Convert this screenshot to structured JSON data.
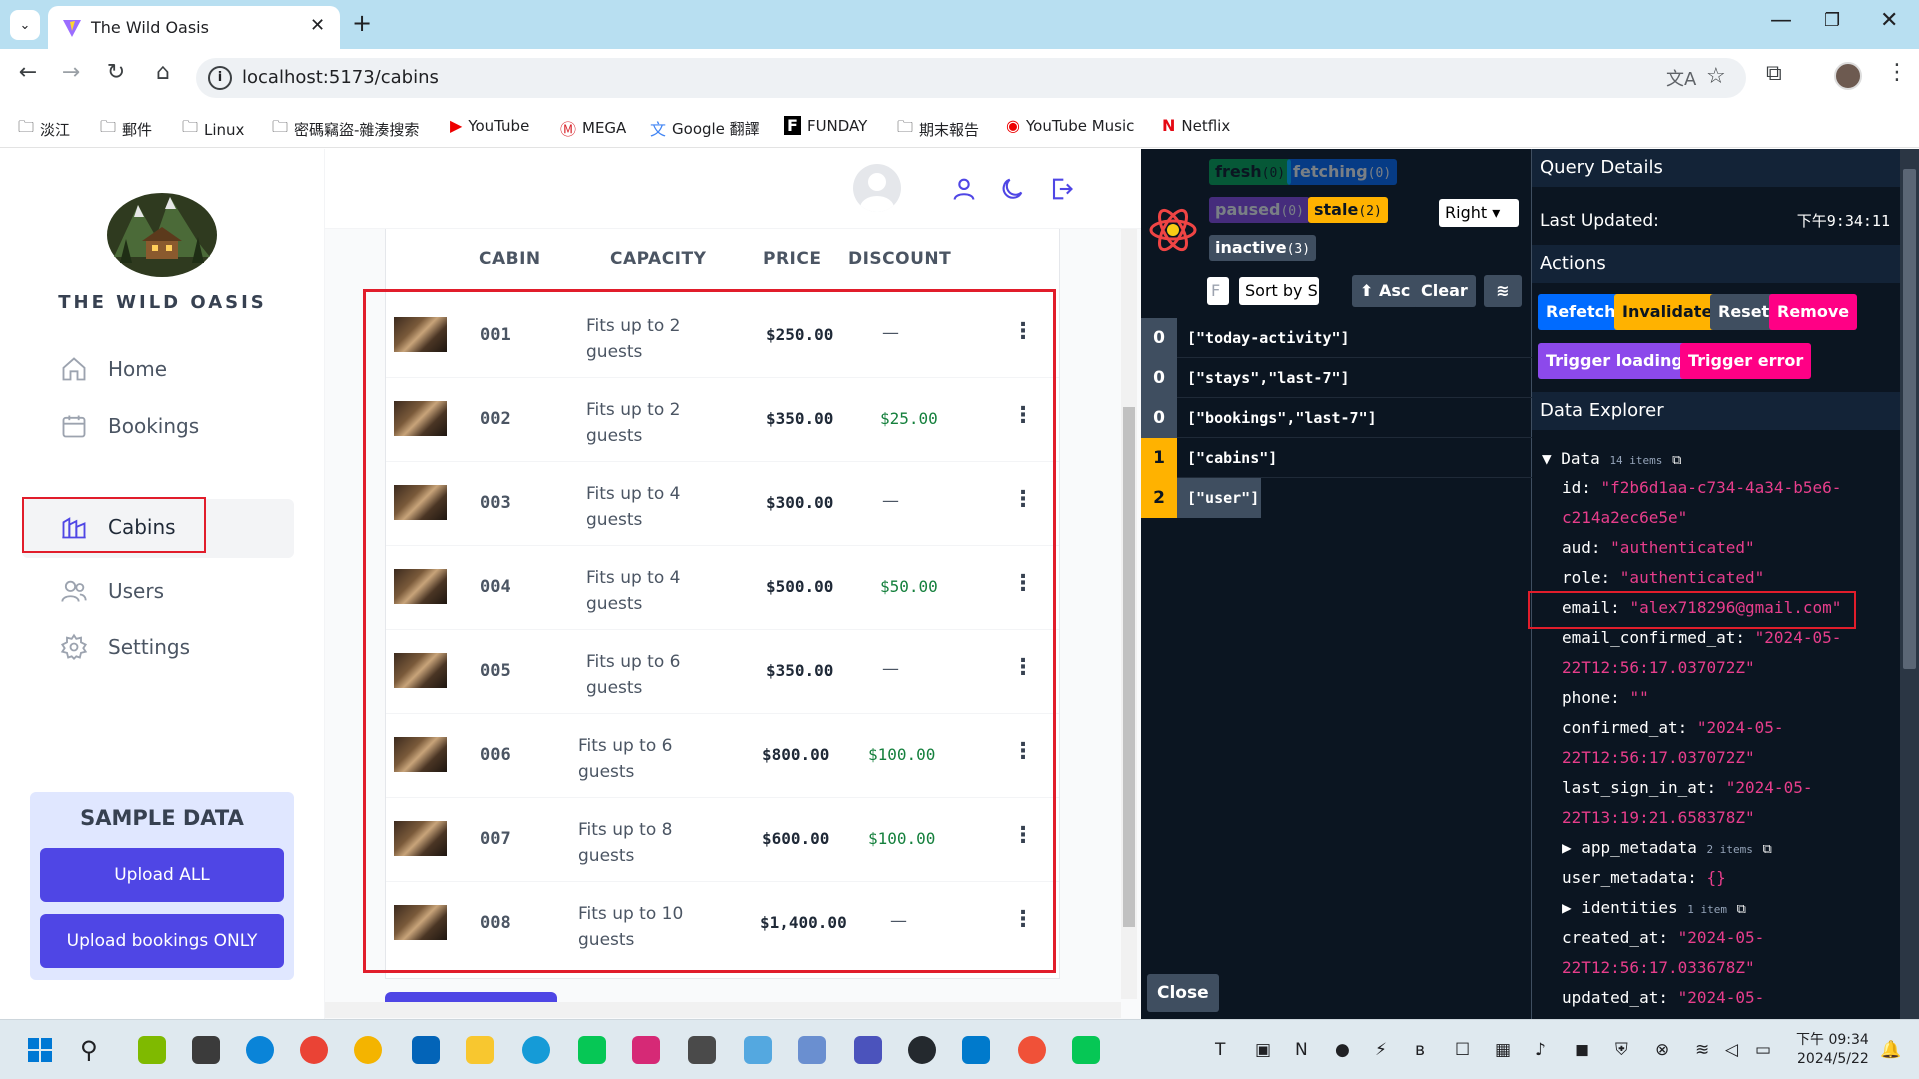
{
  "browser": {
    "tab_title": "The Wild Oasis",
    "url": "localhost:5173/cabins",
    "bookmarks": [
      "淡江",
      "郵件",
      "Linux",
      "密碼竊盜-雜湊搜索",
      "YouTube",
      "MEGA",
      "Google 翻譯",
      "FUNDAY",
      "期末報告",
      "YouTube Music",
      "Netflix"
    ]
  },
  "app": {
    "logo_text": "THE WILD OASIS",
    "nav": [
      {
        "label": "Home",
        "icon": "home-icon"
      },
      {
        "label": "Bookings",
        "icon": "calendar-icon"
      },
      {
        "label": "Cabins",
        "icon": "cabin-icon",
        "active": true
      },
      {
        "label": "Users",
        "icon": "users-icon"
      },
      {
        "label": "Settings",
        "icon": "gear-icon"
      }
    ],
    "sample": {
      "title": "SAMPLE DATA",
      "upload_all": "Upload ALL",
      "upload_bookings": "Upload bookings ONLY"
    },
    "table": {
      "headers": [
        "CABIN",
        "CAPACITY",
        "PRICE",
        "DISCOUNT"
      ],
      "rows": [
        {
          "name": "001",
          "capacity_1": "Fits up to 2",
          "capacity_2": "guests",
          "price": "$250.00",
          "discount": "—"
        },
        {
          "name": "002",
          "capacity_1": "Fits up to 2",
          "capacity_2": "guests",
          "price": "$350.00",
          "discount": "$25.00"
        },
        {
          "name": "003",
          "capacity_1": "Fits up to 4",
          "capacity_2": "guests",
          "price": "$300.00",
          "discount": "—"
        },
        {
          "name": "004",
          "capacity_1": "Fits up to 4",
          "capacity_2": "guests",
          "price": "$500.00",
          "discount": "$50.00"
        },
        {
          "name": "005",
          "capacity_1": "Fits up to 6",
          "capacity_2": "guests",
          "price": "$350.00",
          "discount": "—"
        },
        {
          "name": "006",
          "capacity_1": "Fits up to 6",
          "capacity_2": "guests",
          "price": "$800.00",
          "discount": "$100.00"
        },
        {
          "name": "007",
          "capacity_1": "Fits up to 8",
          "capacity_2": "guests",
          "price": "$600.00",
          "discount": "$100.00"
        },
        {
          "name": "008",
          "capacity_1": "Fits up to 10",
          "capacity_2": "guests",
          "price": "$1,400.00",
          "discount": "—"
        }
      ]
    }
  },
  "devtools": {
    "badges": {
      "fresh": "fresh",
      "fresh_count": "(0)",
      "fetching": "fetching",
      "fetching_count": "(0)",
      "paused": "paused",
      "paused_count": "(0)",
      "stale": "stale",
      "stale_count": "(2)",
      "inactive": "inactive",
      "inactive_count": "(3)"
    },
    "position_select": "Right",
    "filter_placeholder": "F",
    "sort_select": "Sort by S",
    "asc_button": "⬆ Asc",
    "clear_button": "Clear",
    "queries": [
      {
        "count": "0",
        "key": "[\"today-activity\"]",
        "color": "#3f4e60"
      },
      {
        "count": "0",
        "key": "[\"stays\",\"last-7\"]",
        "color": "#3f4e60"
      },
      {
        "count": "0",
        "key": "[\"bookings\",\"last-7\"]",
        "color": "#3f4e60"
      },
      {
        "count": "1",
        "key": "[\"cabins\"]",
        "color": "#ffb200"
      },
      {
        "count": "2",
        "key": "[\"user\"]",
        "color": "#ffb200"
      }
    ],
    "close_button": "Close",
    "details": {
      "query_details": "Query Details",
      "last_updated_label": "Last Updated:",
      "last_updated_value": "下午9:34:11",
      "actions": "Actions",
      "refetch": "Refetch",
      "invalidate": "Invalidate",
      "reset": "Reset",
      "remove": "Remove",
      "trigger_loading": "Trigger loading",
      "trigger_error": "Trigger error",
      "data_explorer": "Data Explorer",
      "data_label": "Data",
      "data_meta": "14 items"
    },
    "explorer": [
      {
        "k": "id: ",
        "v": "\"f2b6d1aa-c734-4a34-b5e6-"
      },
      {
        "k": "",
        "v": "c214a2ec6e5e\""
      },
      {
        "k": "aud: ",
        "v": "\"authenticated\""
      },
      {
        "k": "role: ",
        "v": "\"authenticated\""
      },
      {
        "k": "email: ",
        "v": "\"alex718296@gmail.com\""
      },
      {
        "k": "email_confirmed_at: ",
        "v": "\"2024-05-"
      },
      {
        "k": "",
        "v": "22T12:56:17.037072Z\""
      },
      {
        "k": "phone: ",
        "v": "\"\""
      },
      {
        "k": "confirmed_at: ",
        "v": "\"2024-05-"
      },
      {
        "k": "",
        "v": "22T12:56:17.037072Z\""
      },
      {
        "k": "last_sign_in_at: ",
        "v": "\"2024-05-"
      },
      {
        "k": "",
        "v": "22T13:19:21.658378Z\""
      },
      {
        "k": "▶ app_metadata ",
        "v": "",
        "meta": "2 items"
      },
      {
        "k": "user_metadata: ",
        "v": "{}"
      },
      {
        "k": "▶ identities ",
        "v": "",
        "meta": "1 item"
      },
      {
        "k": "created_at: ",
        "v": "\"2024-05-"
      },
      {
        "k": "",
        "v": "22T12:56:17.033678Z\""
      },
      {
        "k": "updated_at: ",
        "v": "\"2024-05-"
      }
    ]
  },
  "taskbar": {
    "time": "下午 09:34",
    "date": "2024/5/22"
  }
}
